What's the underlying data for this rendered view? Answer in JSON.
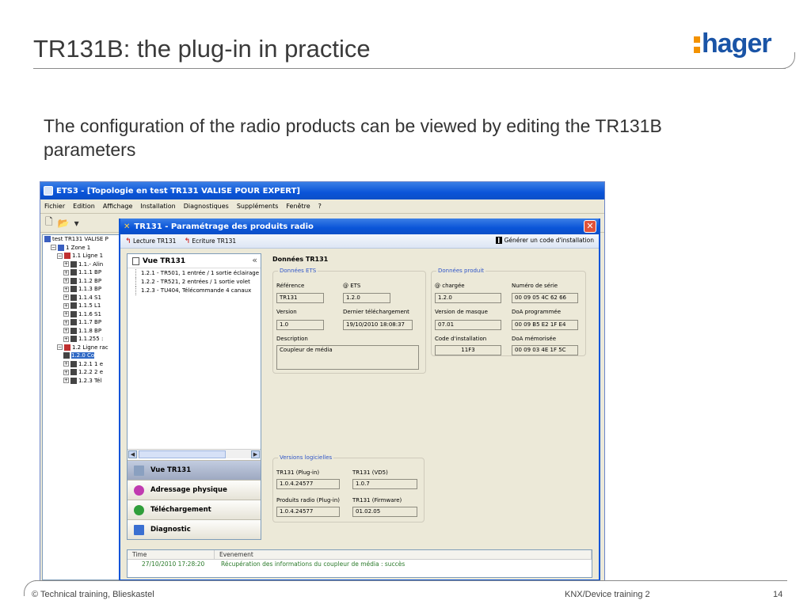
{
  "slide": {
    "title": "TR131B: the plug-in in practice",
    "logo_text": "hager",
    "intro": "The configuration of the radio products can be viewed by editing the TR131B parameters",
    "footer_left": "© Technical training, Blieskastel",
    "footer_mid": "KNX/Device training 2",
    "footer_page": "14"
  },
  "ets": {
    "title": "ETS3 - [Topologie en test TR131 VALISE POUR EXPERT]",
    "menu": [
      "Fichier",
      "Edition",
      "Affichage",
      "Installation",
      "Diagnostiques",
      "Suppléments",
      "Fenêtre",
      "?"
    ],
    "tree": [
      {
        "label": "test TR131 VALISE P",
        "indent": 0,
        "exp": ""
      },
      {
        "label": "1 Zone 1",
        "indent": 1,
        "exp": "−"
      },
      {
        "label": "1.1 Ligne 1",
        "indent": 2,
        "exp": "−"
      },
      {
        "label": "1.1.- Alin",
        "indent": 3,
        "exp": "+"
      },
      {
        "label": "1.1.1 BP",
        "indent": 3,
        "exp": "+"
      },
      {
        "label": "1.1.2 BP",
        "indent": 3,
        "exp": "+"
      },
      {
        "label": "1.1.3 BP",
        "indent": 3,
        "exp": "+"
      },
      {
        "label": "1.1.4 S1",
        "indent": 3,
        "exp": "+"
      },
      {
        "label": "1.1.5 L1",
        "indent": 3,
        "exp": "+"
      },
      {
        "label": "1.1.6 S1",
        "indent": 3,
        "exp": "+"
      },
      {
        "label": "1.1.7 BP",
        "indent": 3,
        "exp": "+"
      },
      {
        "label": "1.1.8 BP",
        "indent": 3,
        "exp": "+"
      },
      {
        "label": "1.1.255 :",
        "indent": 3,
        "exp": "+"
      },
      {
        "label": "1.2 Ligne rac",
        "indent": 2,
        "exp": "−"
      },
      {
        "label": "1.2.0 Co",
        "indent": 3,
        "exp": "",
        "selected": true
      },
      {
        "label": "1.2.1 1 e",
        "indent": 3,
        "exp": "+"
      },
      {
        "label": "1.2.2 2 e",
        "indent": 3,
        "exp": "+"
      },
      {
        "label": "1.2.3 Tél",
        "indent": 3,
        "exp": "+"
      }
    ]
  },
  "dialog": {
    "title": "TR131 - Paramétrage des produits radio",
    "close": "✕",
    "toolbar": {
      "read": "Lecture TR131",
      "write": "Ecriture TR131",
      "generate": "Générer un code d'installation"
    },
    "vue": {
      "title": "Vue TR131",
      "collapse": "«",
      "items": [
        "1.2.1 - TR501, 1 entrée / 1 sortie éclairage",
        "1.2.2 - TR521, 2 entrées / 1 sortie volet",
        "1.2.3 - TU404, Télécommande 4 canaux"
      ],
      "grip": "·····"
    },
    "nav": [
      {
        "label": "Vue TR131",
        "color": "#8aa0c0"
      },
      {
        "label": "Adressage physique",
        "color": "#c03ab0"
      },
      {
        "label": "Téléchargement",
        "color": "#2f9e3a"
      },
      {
        "label": "Diagnostic",
        "color": "#3a6fd1"
      }
    ],
    "content": {
      "title": "Données TR131",
      "ets_group": {
        "label": "Données ETS",
        "reference_label": "Référence",
        "reference": "TR131",
        "ets_label": "@ ETS",
        "ets": "1.2.0",
        "version_label": "Version",
        "version": "1.0",
        "last_dl_label": "Dernier téléchargement",
        "last_dl": "19/10/2010 18:08:37",
        "description_label": "Description",
        "description": "Coupleur de média"
      },
      "product_group": {
        "label": "Données produit",
        "loaded_label": "@ chargée",
        "loaded": "1.2.0",
        "serial_label": "Numéro de série",
        "serial": "00 09 05 4C 62 66",
        "mask_label": "Version de masque",
        "mask": "07.01",
        "doa_prog_label": "DoA programmée",
        "doa_prog": "00 09 B5 E2 1F E4",
        "install_code_label": "Code d'installation",
        "install_code": "11F3",
        "doa_mem_label": "DoA mémorisée",
        "doa_mem": "00 09 03 4E 1F 5C"
      },
      "software_group": {
        "label": "Versions logicielles",
        "plugin_label": "TR131 (Plug-in)",
        "plugin": "1.0.4.24577",
        "vd5_label": "TR131 (VD5)",
        "vd5": "1.0.7",
        "radio_label": "Produits radio (Plug-in)",
        "radio": "1.0.4.24577",
        "firmware_label": "TR131 (Firmware)",
        "firmware": "01.02.05"
      }
    },
    "log": {
      "col_time": "Time",
      "col_event": "Evenement",
      "rows": [
        {
          "time": "27/10/2010 17:28:20",
          "event": "Récupération des informations du coupleur de média : succès"
        }
      ]
    }
  }
}
